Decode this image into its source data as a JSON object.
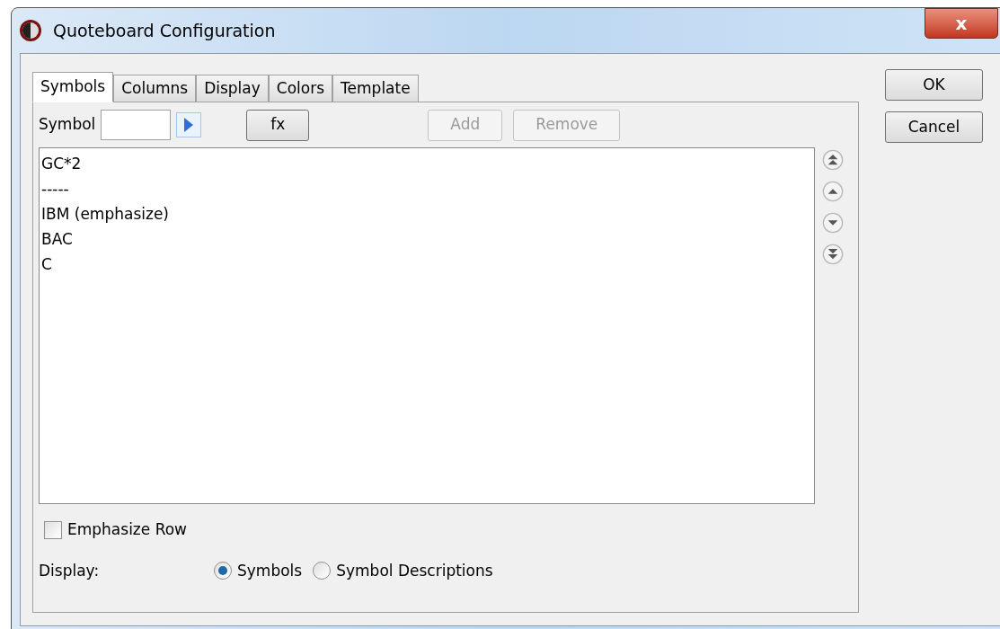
{
  "window": {
    "title": "Quoteboard Configuration",
    "close": "x"
  },
  "tabs": [
    {
      "label": "Symbols",
      "selected": true
    },
    {
      "label": "Columns",
      "selected": false
    },
    {
      "label": "Display",
      "selected": false
    },
    {
      "label": "Colors",
      "selected": false
    },
    {
      "label": "Template",
      "selected": false
    }
  ],
  "symbol_field": {
    "label": "Symbol"
  },
  "toolbar_buttons": [
    {
      "label": "fx",
      "disabled": false
    },
    {
      "label": "Add",
      "disabled": true
    },
    {
      "label": "Remove",
      "disabled": true
    }
  ],
  "symbols": [
    "GC*2",
    "-----",
    "IBM (emphasize)",
    "BAC",
    "C"
  ],
  "emphasize_row": {
    "label": "Emphasize Row",
    "checked": false
  },
  "display": {
    "label": "Display:",
    "options": [
      {
        "label": "Symbols",
        "selected": true
      },
      {
        "label": "Symbol Descriptions",
        "selected": false
      }
    ]
  },
  "dialog_buttons": [
    "OK",
    "Cancel"
  ]
}
